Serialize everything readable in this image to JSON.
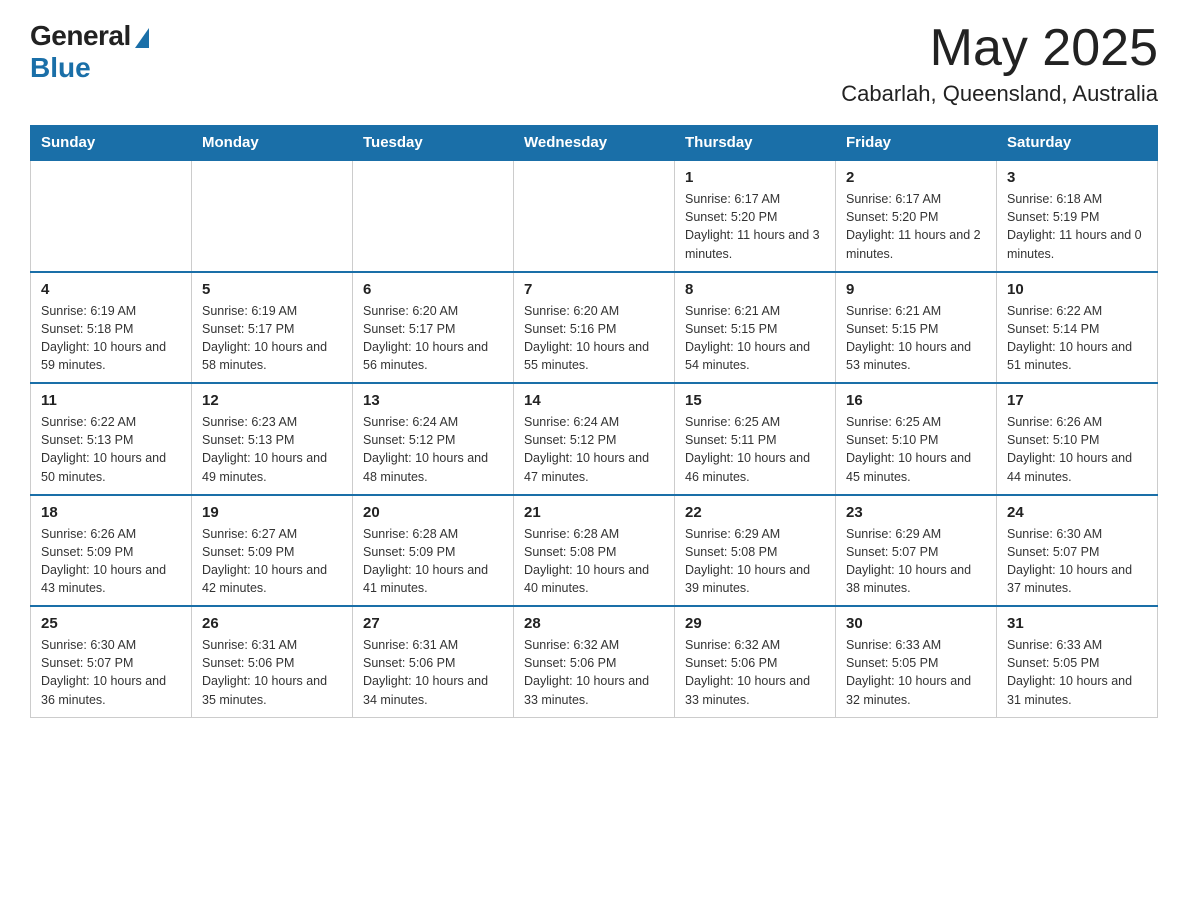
{
  "header": {
    "logo_general": "General",
    "logo_blue": "Blue",
    "month": "May 2025",
    "location": "Cabarlah, Queensland, Australia"
  },
  "weekdays": [
    "Sunday",
    "Monday",
    "Tuesday",
    "Wednesday",
    "Thursday",
    "Friday",
    "Saturday"
  ],
  "weeks": [
    [
      {
        "day": "",
        "info": ""
      },
      {
        "day": "",
        "info": ""
      },
      {
        "day": "",
        "info": ""
      },
      {
        "day": "",
        "info": ""
      },
      {
        "day": "1",
        "info": "Sunrise: 6:17 AM\nSunset: 5:20 PM\nDaylight: 11 hours and 3 minutes."
      },
      {
        "day": "2",
        "info": "Sunrise: 6:17 AM\nSunset: 5:20 PM\nDaylight: 11 hours and 2 minutes."
      },
      {
        "day": "3",
        "info": "Sunrise: 6:18 AM\nSunset: 5:19 PM\nDaylight: 11 hours and 0 minutes."
      }
    ],
    [
      {
        "day": "4",
        "info": "Sunrise: 6:19 AM\nSunset: 5:18 PM\nDaylight: 10 hours and 59 minutes."
      },
      {
        "day": "5",
        "info": "Sunrise: 6:19 AM\nSunset: 5:17 PM\nDaylight: 10 hours and 58 minutes."
      },
      {
        "day": "6",
        "info": "Sunrise: 6:20 AM\nSunset: 5:17 PM\nDaylight: 10 hours and 56 minutes."
      },
      {
        "day": "7",
        "info": "Sunrise: 6:20 AM\nSunset: 5:16 PM\nDaylight: 10 hours and 55 minutes."
      },
      {
        "day": "8",
        "info": "Sunrise: 6:21 AM\nSunset: 5:15 PM\nDaylight: 10 hours and 54 minutes."
      },
      {
        "day": "9",
        "info": "Sunrise: 6:21 AM\nSunset: 5:15 PM\nDaylight: 10 hours and 53 minutes."
      },
      {
        "day": "10",
        "info": "Sunrise: 6:22 AM\nSunset: 5:14 PM\nDaylight: 10 hours and 51 minutes."
      }
    ],
    [
      {
        "day": "11",
        "info": "Sunrise: 6:22 AM\nSunset: 5:13 PM\nDaylight: 10 hours and 50 minutes."
      },
      {
        "day": "12",
        "info": "Sunrise: 6:23 AM\nSunset: 5:13 PM\nDaylight: 10 hours and 49 minutes."
      },
      {
        "day": "13",
        "info": "Sunrise: 6:24 AM\nSunset: 5:12 PM\nDaylight: 10 hours and 48 minutes."
      },
      {
        "day": "14",
        "info": "Sunrise: 6:24 AM\nSunset: 5:12 PM\nDaylight: 10 hours and 47 minutes."
      },
      {
        "day": "15",
        "info": "Sunrise: 6:25 AM\nSunset: 5:11 PM\nDaylight: 10 hours and 46 minutes."
      },
      {
        "day": "16",
        "info": "Sunrise: 6:25 AM\nSunset: 5:10 PM\nDaylight: 10 hours and 45 minutes."
      },
      {
        "day": "17",
        "info": "Sunrise: 6:26 AM\nSunset: 5:10 PM\nDaylight: 10 hours and 44 minutes."
      }
    ],
    [
      {
        "day": "18",
        "info": "Sunrise: 6:26 AM\nSunset: 5:09 PM\nDaylight: 10 hours and 43 minutes."
      },
      {
        "day": "19",
        "info": "Sunrise: 6:27 AM\nSunset: 5:09 PM\nDaylight: 10 hours and 42 minutes."
      },
      {
        "day": "20",
        "info": "Sunrise: 6:28 AM\nSunset: 5:09 PM\nDaylight: 10 hours and 41 minutes."
      },
      {
        "day": "21",
        "info": "Sunrise: 6:28 AM\nSunset: 5:08 PM\nDaylight: 10 hours and 40 minutes."
      },
      {
        "day": "22",
        "info": "Sunrise: 6:29 AM\nSunset: 5:08 PM\nDaylight: 10 hours and 39 minutes."
      },
      {
        "day": "23",
        "info": "Sunrise: 6:29 AM\nSunset: 5:07 PM\nDaylight: 10 hours and 38 minutes."
      },
      {
        "day": "24",
        "info": "Sunrise: 6:30 AM\nSunset: 5:07 PM\nDaylight: 10 hours and 37 minutes."
      }
    ],
    [
      {
        "day": "25",
        "info": "Sunrise: 6:30 AM\nSunset: 5:07 PM\nDaylight: 10 hours and 36 minutes."
      },
      {
        "day": "26",
        "info": "Sunrise: 6:31 AM\nSunset: 5:06 PM\nDaylight: 10 hours and 35 minutes."
      },
      {
        "day": "27",
        "info": "Sunrise: 6:31 AM\nSunset: 5:06 PM\nDaylight: 10 hours and 34 minutes."
      },
      {
        "day": "28",
        "info": "Sunrise: 6:32 AM\nSunset: 5:06 PM\nDaylight: 10 hours and 33 minutes."
      },
      {
        "day": "29",
        "info": "Sunrise: 6:32 AM\nSunset: 5:06 PM\nDaylight: 10 hours and 33 minutes."
      },
      {
        "day": "30",
        "info": "Sunrise: 6:33 AM\nSunset: 5:05 PM\nDaylight: 10 hours and 32 minutes."
      },
      {
        "day": "31",
        "info": "Sunrise: 6:33 AM\nSunset: 5:05 PM\nDaylight: 10 hours and 31 minutes."
      }
    ]
  ]
}
